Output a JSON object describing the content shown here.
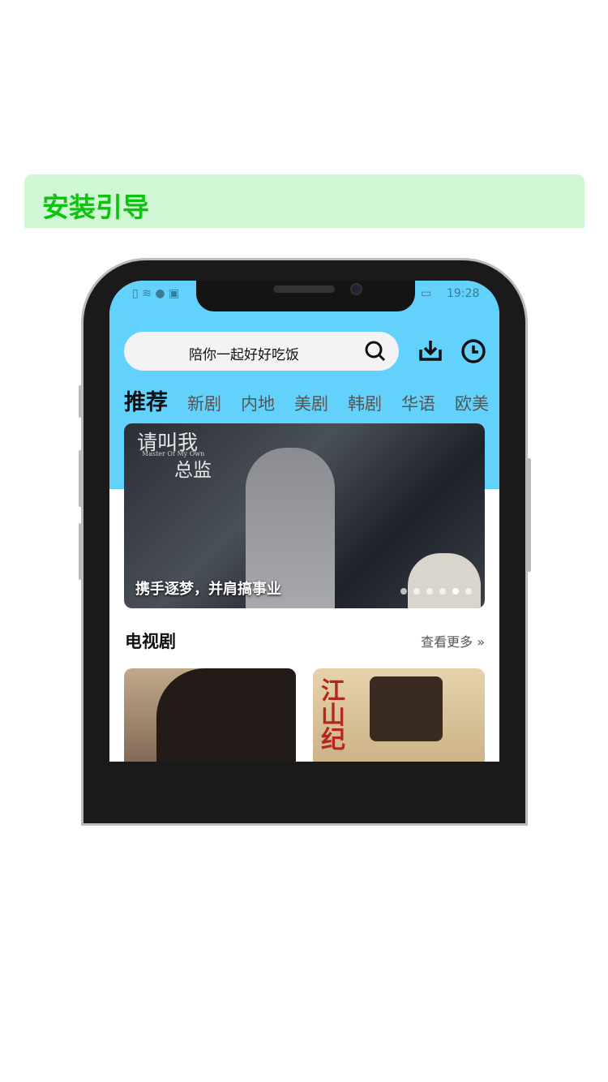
{
  "guide": {
    "title": "安装引导"
  },
  "status_bar": {
    "time": "19:28"
  },
  "search": {
    "placeholder": "陪你一起好好吃饭"
  },
  "tabs": [
    "推荐",
    "新剧",
    "内地",
    "美剧",
    "韩剧",
    "华语",
    "欧美"
  ],
  "banner": {
    "show_title": "请叫我",
    "show_title2": "总监",
    "show_subtitle": "Master Of My Own",
    "caption": "携手逐梦，并肩搞事业",
    "slide_count": 6,
    "active_slide": 5
  },
  "section": {
    "title": "电视剧",
    "more": "查看更多"
  },
  "cards": [
    {
      "poster_text": ""
    },
    {
      "poster_text": "江山纪"
    }
  ],
  "colors": {
    "header": "#62d2fd",
    "guide_bg": "#cff7d3",
    "guide_text": "#0dc30d"
  }
}
